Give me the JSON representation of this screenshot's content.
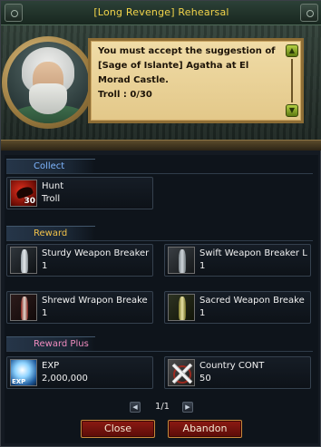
{
  "window": {
    "title": "[Long Revenge] Rehearsal"
  },
  "quest": {
    "description": "You must accept the suggestion of [Sage of Islante] Agatha at El Morad Castle.",
    "progress": "Troll : 0/30",
    "portrait": "sage-npc-portrait"
  },
  "collect": {
    "header": "Collect",
    "items": [
      {
        "name": "Hunt",
        "sub": "Troll",
        "count": "30",
        "icon": "hunt-icon"
      }
    ]
  },
  "reward": {
    "header": "Reward",
    "items": [
      {
        "name": "Sturdy Weapon Breaker",
        "qty": "1",
        "icon": "sturdy-weapon-breaker-icon"
      },
      {
        "name": "Swift Weapon Breaker L",
        "qty": "1",
        "icon": "swift-weapon-breaker-icon"
      },
      {
        "name": "Shrewd Wrapon Breake",
        "qty": "1",
        "icon": "shrewd-weapon-breaker-icon"
      },
      {
        "name": "Sacred Weapon Breake",
        "qty": "1",
        "icon": "sacred-weapon-breaker-icon"
      }
    ]
  },
  "reward_plus": {
    "header": "Reward Plus",
    "items": [
      {
        "name": "EXP",
        "value": "2,000,000",
        "icon_label": "EXP",
        "icon": "exp-icon"
      },
      {
        "name": "Country CONT",
        "value": "50",
        "icon": "country-contribution-icon"
      }
    ]
  },
  "pager": {
    "text": "1/1"
  },
  "buttons": {
    "close": "Close",
    "abandon": "Abandon"
  },
  "colors": {
    "title": "#f2d44a",
    "collect_header": "#7fb6ff",
    "reward_header": "#f2c24a",
    "reward_plus_header": "#f08cc0",
    "button_bg": "#8c1a13"
  }
}
